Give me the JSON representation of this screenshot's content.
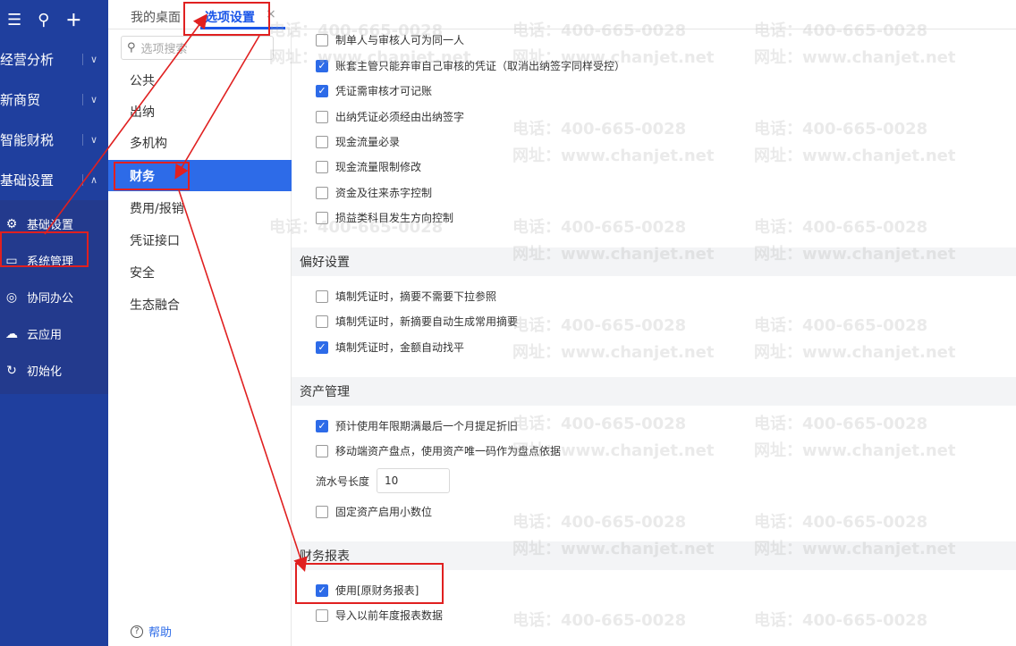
{
  "sidebar": {
    "top_icons": [
      "menu-icon",
      "search-icon",
      "plus-icon"
    ],
    "groups": [
      {
        "label": "经营分析"
      },
      {
        "label": "新商贸"
      },
      {
        "label": "智能财税"
      },
      {
        "label": "基础设置"
      }
    ],
    "sub_items": [
      {
        "label": "基础设置",
        "icon": "gear-icon"
      },
      {
        "label": "系统管理",
        "icon": "monitor-icon"
      },
      {
        "label": "协同办公",
        "icon": "collab-icon"
      },
      {
        "label": "云应用",
        "icon": "cloud-icon"
      },
      {
        "label": "初始化",
        "icon": "reset-icon"
      }
    ]
  },
  "tabs": {
    "desktop": "我的桌面",
    "options": "选项设置",
    "close": "×"
  },
  "options_menu": {
    "search_placeholder": "选项搜索",
    "items": [
      "公共",
      "出纳",
      "多机构",
      "财务",
      "费用/报销",
      "凭证接口",
      "安全",
      "生态融合"
    ],
    "active": "财务",
    "help": "帮助"
  },
  "settings": {
    "voucher_rows": [
      {
        "label": "制单人与审核人可为同一人",
        "checked": false
      },
      {
        "label": "账套主管只能弃审自己审核的凭证（取消出纳签字同样受控）",
        "checked": true
      },
      {
        "label": "凭证需审核才可记账",
        "checked": true
      },
      {
        "label": "出纳凭证必须经由出纳签字",
        "checked": false
      },
      {
        "label": "现金流量必录",
        "checked": false
      },
      {
        "label": "现金流量限制修改",
        "checked": false
      },
      {
        "label": "资金及往来赤字控制",
        "checked": false
      },
      {
        "label": "损益类科目发生方向控制",
        "checked": false
      }
    ],
    "preference": {
      "title": "偏好设置",
      "rows": [
        {
          "label": "填制凭证时，摘要不需要下拉参照",
          "checked": false
        },
        {
          "label": "填制凭证时，新摘要自动生成常用摘要",
          "checked": false
        },
        {
          "label": "填制凭证时，金额自动找平",
          "checked": true
        }
      ]
    },
    "asset": {
      "title": "资产管理",
      "rows": [
        {
          "label": "预计使用年限期满最后一个月提足折旧",
          "checked": true
        },
        {
          "label": "移动端资产盘点，使用资产唯一码作为盘点依据",
          "checked": false
        }
      ],
      "serial_label": "流水号长度",
      "serial_value": "10",
      "decimal_row": {
        "label": "固定资产启用小数位",
        "checked": false
      }
    },
    "report": {
      "title": "财务报表",
      "rows": [
        {
          "label": "使用[原财务报表]",
          "checked": true
        },
        {
          "label": "导入以前年度报表数据",
          "checked": false
        }
      ]
    }
  },
  "watermark": {
    "phone": "电话：400-665-0028",
    "site": "网址：www.chanjet.net"
  },
  "colors": {
    "sidebar": "#1f3f9e",
    "accent": "#2d6be8",
    "highlight": "#e02020"
  }
}
